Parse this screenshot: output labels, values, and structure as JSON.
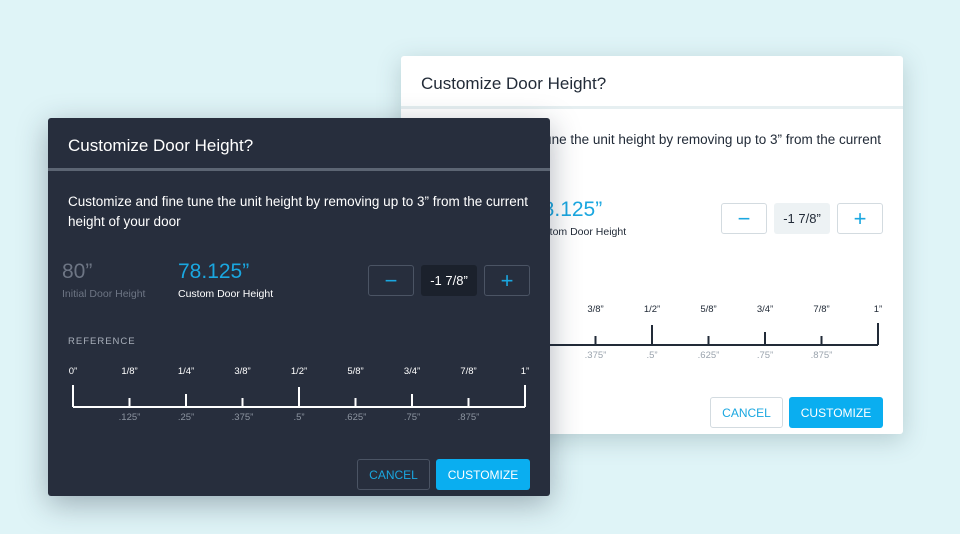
{
  "dialog": {
    "title": "Customize Door Height?",
    "description": "Customize and fine tune the unit height by removing up to 3” from the current height of your door",
    "initial_value": "80”",
    "initial_label": "Initial Door Height",
    "custom_value": "78.125”",
    "custom_label": "Custom Door Height",
    "minus_icon": "−",
    "plus_icon": "+",
    "adjustment": "-1 7/8”",
    "reference_label": "REFERENCE",
    "ruler_top": [
      "0”",
      "1/8”",
      "1/4”",
      "3/8”",
      "1/2”",
      "5/8”",
      "3/4”",
      "7/8”",
      "1”"
    ],
    "ruler_bottom": [
      ".125”",
      ".25”",
      ".375”",
      ".5”",
      ".625”",
      ".75”",
      ".875”"
    ],
    "cancel": "CANCEL",
    "customize": "CUSTOMIZE"
  },
  "colors": {
    "accent": "#0aaef0",
    "dark_bg": "#272e3d",
    "page_bg": "#dff4f7"
  }
}
